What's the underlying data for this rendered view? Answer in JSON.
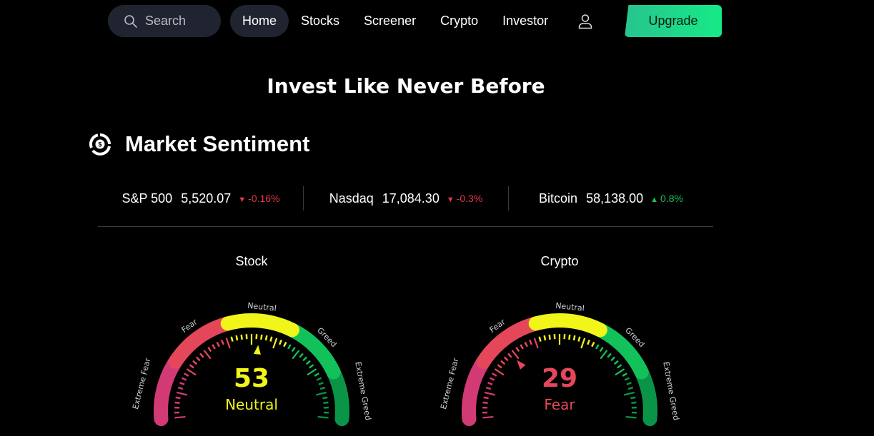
{
  "nav": {
    "search_placeholder": "Search",
    "items": [
      {
        "label": "Home",
        "active": true
      },
      {
        "label": "Stocks"
      },
      {
        "label": "Screener"
      },
      {
        "label": "Crypto"
      },
      {
        "label": "Investor"
      }
    ],
    "user_icon": "user-icon",
    "upgrade_label": "Upgrade"
  },
  "hero": {
    "title": "Invest Like Never Before"
  },
  "market_sentiment": {
    "title": "Market Sentiment",
    "icon": "dollar-target-icon",
    "tickers": [
      {
        "name": "S&P 500",
        "price": "5,520.07",
        "change": "-0.16%",
        "direction": "down"
      },
      {
        "name": "Nasdaq",
        "price": "17,084.30",
        "change": "-0.3%",
        "direction": "down"
      },
      {
        "name": "Bitcoin",
        "price": "58,138.00",
        "change": "0.8%",
        "direction": "up"
      }
    ],
    "colors": {
      "down": "#e8374b",
      "up": "#19c15a"
    },
    "gauge_labels": [
      "Extreme Fear",
      "Fear",
      "Neutral",
      "Greed",
      "Extreme Greed"
    ],
    "gauge_colors": [
      "#d23a76",
      "#e5475a",
      "#f1f519",
      "#13c15a",
      "#0a9448"
    ],
    "gauges": [
      {
        "title": "Stock",
        "value": 53,
        "label": "Neutral",
        "value_color": "#f1f519"
      },
      {
        "title": "Crypto",
        "value": 29,
        "label": "Fear",
        "value_color": "#e5475a"
      }
    ]
  }
}
